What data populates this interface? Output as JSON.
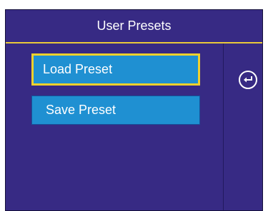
{
  "header": {
    "title": "User Presets"
  },
  "menu": {
    "items": [
      {
        "label": "Load Preset",
        "selected": true
      },
      {
        "label": "Save Preset",
        "selected": false
      }
    ]
  },
  "side_panel": {
    "icon": "back-arrow-icon"
  },
  "colors": {
    "background": "#372a84",
    "accent": "#e9c93a",
    "button": "#1f90d2",
    "text": "#ffffff"
  }
}
